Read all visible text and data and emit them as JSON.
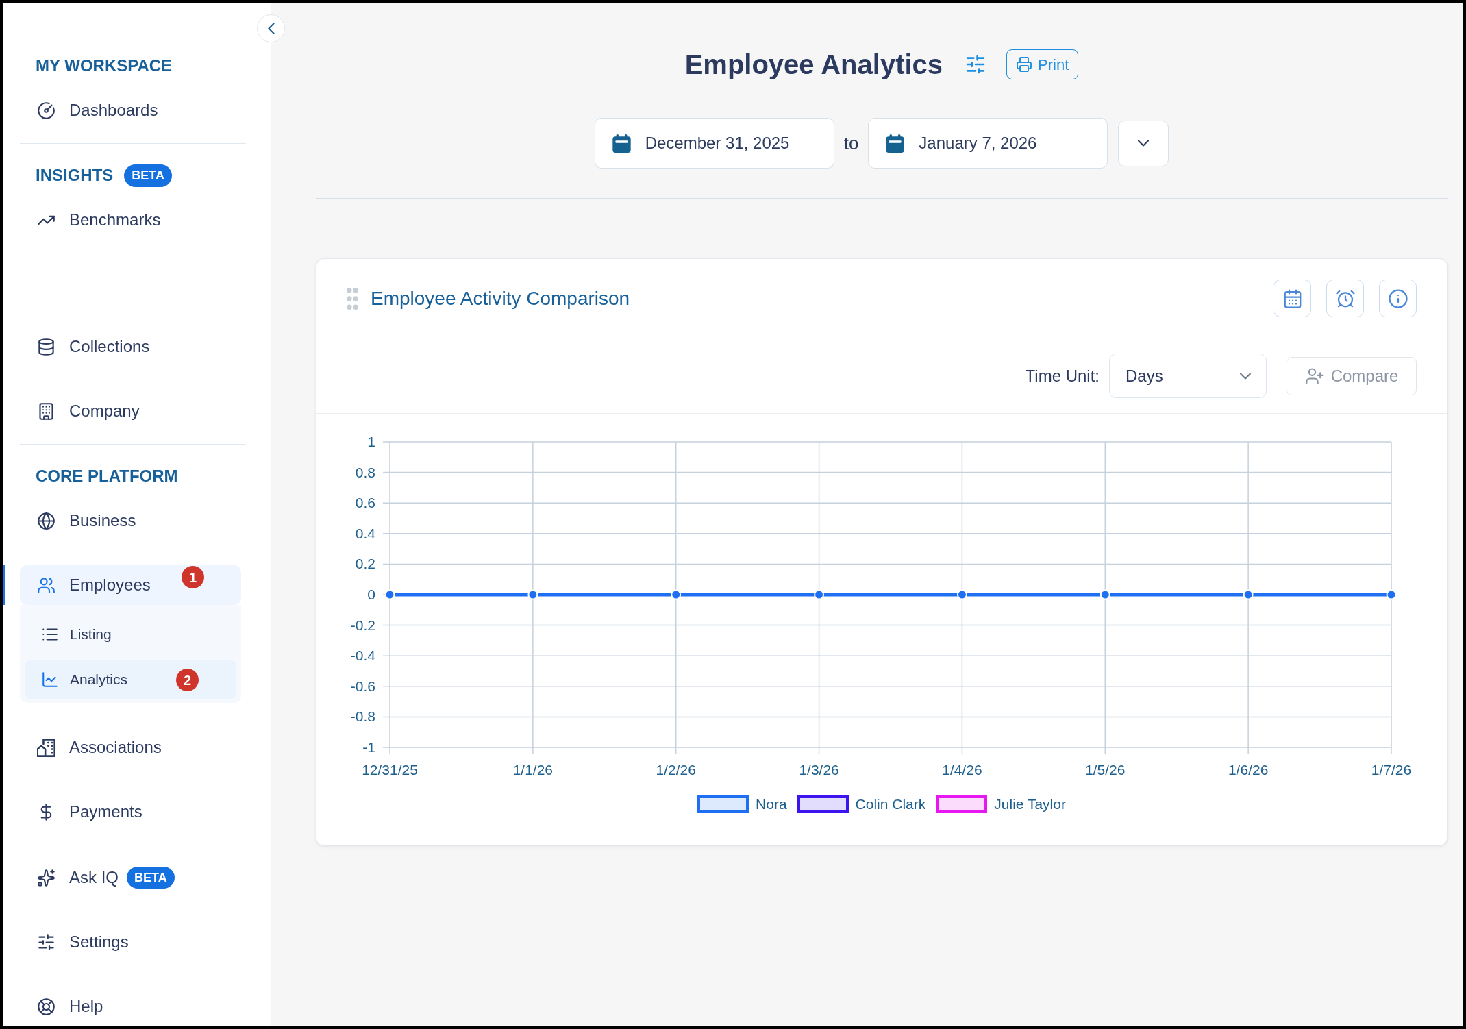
{
  "sidebar": {
    "sections": [
      {
        "title": "MY WORKSPACE",
        "items": [
          {
            "label": "Dashboards",
            "selected": false
          }
        ]
      },
      {
        "title": "INSIGHTS",
        "badge": "BETA",
        "items": [
          {
            "label": "Benchmarks",
            "selected": false
          },
          {
            "label": "Collections",
            "selected": false
          },
          {
            "label": "Company",
            "selected": false
          }
        ]
      },
      {
        "title": "CORE PLATFORM",
        "items": [
          {
            "label": "Business",
            "selected": false
          },
          {
            "label": "Employees",
            "selected": true,
            "expanded": true,
            "marker": "1",
            "children": [
              {
                "label": "Listing",
                "selected": false
              },
              {
                "label": "Analytics",
                "selected": true,
                "marker": "2"
              }
            ]
          },
          {
            "label": "Associations",
            "selected": false
          },
          {
            "label": "Payments",
            "selected": false
          }
        ]
      },
      {
        "items": [
          {
            "label": "Ask IQ",
            "badge": "BETA",
            "selected": false
          },
          {
            "label": "Settings",
            "selected": false
          },
          {
            "label": "Help",
            "selected": false
          }
        ]
      }
    ]
  },
  "header": {
    "title": "Employee Analytics",
    "print_button": "Print",
    "date_range": {
      "start": "December 31, 2025",
      "separator": "to",
      "end": "January 7, 2026"
    }
  },
  "card": {
    "title": "Employee Activity Comparison",
    "time_unit": {
      "label": "Time Unit:",
      "value": "Days"
    },
    "compare_button": {
      "label": "Compare",
      "disabled": true
    },
    "chart_data": {
      "type": "line",
      "categories": [
        "12/31/25",
        "1/1/26",
        "1/2/26",
        "1/3/26",
        "1/4/26",
        "1/5/26",
        "1/6/26",
        "1/7/26"
      ],
      "series": [
        {
          "name": "Nora",
          "color": "#1f6ff2",
          "marker": "circle",
          "values": [
            0,
            0,
            0,
            0,
            0,
            0,
            0,
            0
          ]
        },
        {
          "name": "Colin Clark",
          "color": "#3b14ef",
          "values": [
            null,
            null,
            null,
            null,
            null,
            null,
            null,
            null
          ]
        },
        {
          "name": "Julie Taylor",
          "color": "#e617f0",
          "values": [
            null,
            null,
            null,
            null,
            null,
            null,
            null,
            null
          ]
        }
      ],
      "ylim": [
        -1,
        1
      ],
      "yticks": [
        {
          "value": 1,
          "label": "1"
        },
        {
          "value": 0.8,
          "label": "0.8"
        },
        {
          "value": 0.6,
          "label": "0.6"
        },
        {
          "value": 0.4,
          "label": "0.4"
        },
        {
          "value": 0.2,
          "label": "0.2"
        },
        {
          "value": 0,
          "label": "0"
        },
        {
          "value": -0.2,
          "label": "-0.2"
        },
        {
          "value": -0.4,
          "label": "-0.4"
        },
        {
          "value": -0.6,
          "label": "-0.6"
        },
        {
          "value": -0.8,
          "label": "-0.8"
        },
        {
          "value": -1,
          "label": "-1"
        }
      ],
      "grid": true,
      "legend": "bottom"
    }
  }
}
